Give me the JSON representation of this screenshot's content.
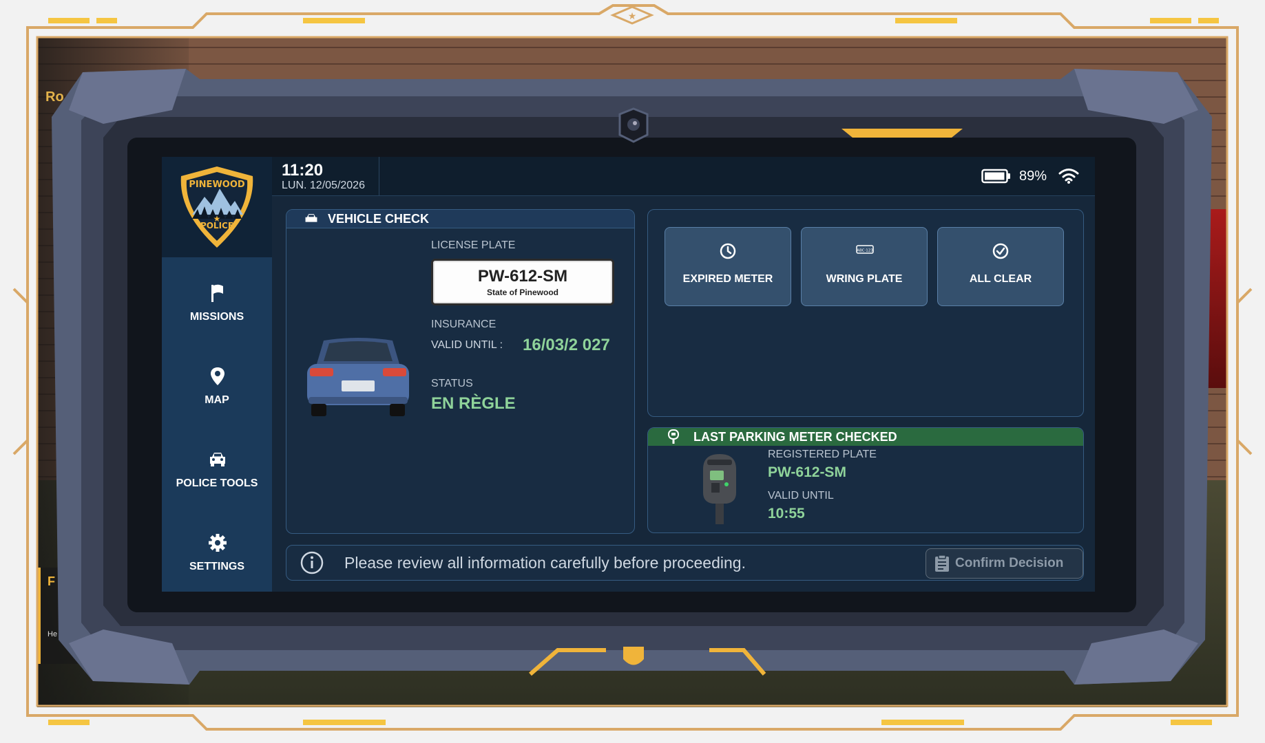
{
  "topbar": {
    "time": "11:20",
    "date": "LUN. 12/05/2026",
    "battery_percent": "89%",
    "battery_level": 0.89
  },
  "logo": {
    "line1": "PINEWOOD",
    "line2": "POLICE"
  },
  "sidebar": {
    "items": [
      {
        "label": "MISSIONS",
        "icon": "flag-icon"
      },
      {
        "label": "MAP",
        "icon": "map-pin-icon"
      },
      {
        "label": "POLICE TOOLS",
        "icon": "car-icon"
      },
      {
        "label": "SETTINGS",
        "icon": "gear-icon"
      }
    ]
  },
  "vehicle_check": {
    "title": "VEHICLE CHECK",
    "license_plate_label": "LICENSE PLATE",
    "plate_number": "PW-612-SM",
    "plate_state": "State of Pinewood",
    "insurance_label": "INSURANCE",
    "valid_until_label": "VALID UNTIL :",
    "valid_until_value": "16/03/2 027",
    "status_label": "STATUS",
    "status_value": "EN RÈGLE",
    "vehicle_color": "#4f6fa6"
  },
  "actions": [
    {
      "label": "EXPIRED METER",
      "icon": "clock-icon"
    },
    {
      "label": "WRING PLATE",
      "icon": "plate-icon",
      "icon_text": "ABC·123"
    },
    {
      "label": "ALL CLEAR",
      "icon": "check-circle-icon"
    }
  ],
  "last_meter": {
    "title": "LAST PARKING METER CHECKED",
    "registered_plate_label": "REGISTERED PLATE",
    "registered_plate_value": "PW-612-SM",
    "valid_until_label": "VALID UNTIL",
    "valid_until_value": "10:55"
  },
  "footer": {
    "info_text": "Please review all information carefully before proceeding.",
    "confirm_label": "Confirm Decision"
  },
  "hud": {
    "left_label_fragment": "Ro",
    "left_panel_title": "F",
    "left_panel_text": "He\nenfo"
  },
  "colors": {
    "accent_gold": "#f0b43a",
    "frame_gold": "#d9a867",
    "status_green": "#8fd39a",
    "header_green": "#2a6a3f",
    "screen_bg": "#16273a"
  }
}
